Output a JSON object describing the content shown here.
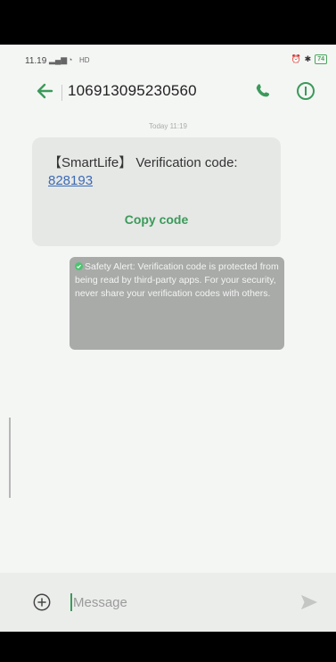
{
  "status_bar": {
    "time": "11.19",
    "indicators": "HD",
    "battery": "74"
  },
  "header": {
    "sender": "106913095230560",
    "back_icon": "arrow-left-icon",
    "call_icon": "phone-icon",
    "info_icon": "info-icon"
  },
  "thread": {
    "timestamp": "Today 11:19",
    "message": {
      "text": "【SmartLife】 Verification code:",
      "code": "828193",
      "copy_label": "Copy code"
    },
    "safety_alert": {
      "text": "Safety Alert: Verification code is protected from being read by third-party apps. For your security, never share your verification codes with others."
    }
  },
  "composer": {
    "placeholder": "Message",
    "value": ""
  },
  "colors": {
    "accent": "#3b9a5a",
    "link": "#3c6ab4",
    "bubble": "#e6e8e6",
    "alert": "#a8aba8"
  }
}
